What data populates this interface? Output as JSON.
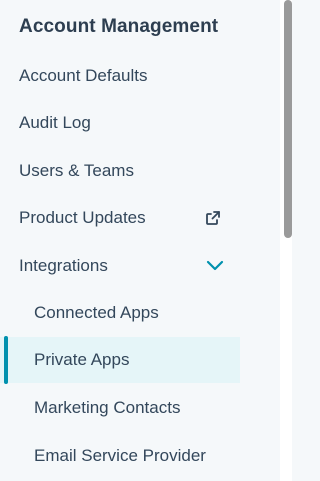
{
  "sidebar": {
    "section_title": "Account Management",
    "items": [
      {
        "label": "Account Defaults"
      },
      {
        "label": "Audit Log"
      },
      {
        "label": "Users & Teams"
      },
      {
        "label": "Product Updates",
        "icon": "external-link-icon"
      },
      {
        "label": "Integrations",
        "icon": "chevron-down-icon",
        "expanded": true
      },
      {
        "label": "Connected Apps"
      },
      {
        "label": "Private Apps",
        "active": true
      },
      {
        "label": "Marketing Contacts"
      },
      {
        "label": "Email Service Provider"
      }
    ]
  },
  "colors": {
    "accent": "#0091ae",
    "active_background": "#e5f5f8",
    "text": "#33475b",
    "background": "#f5f8fa"
  }
}
